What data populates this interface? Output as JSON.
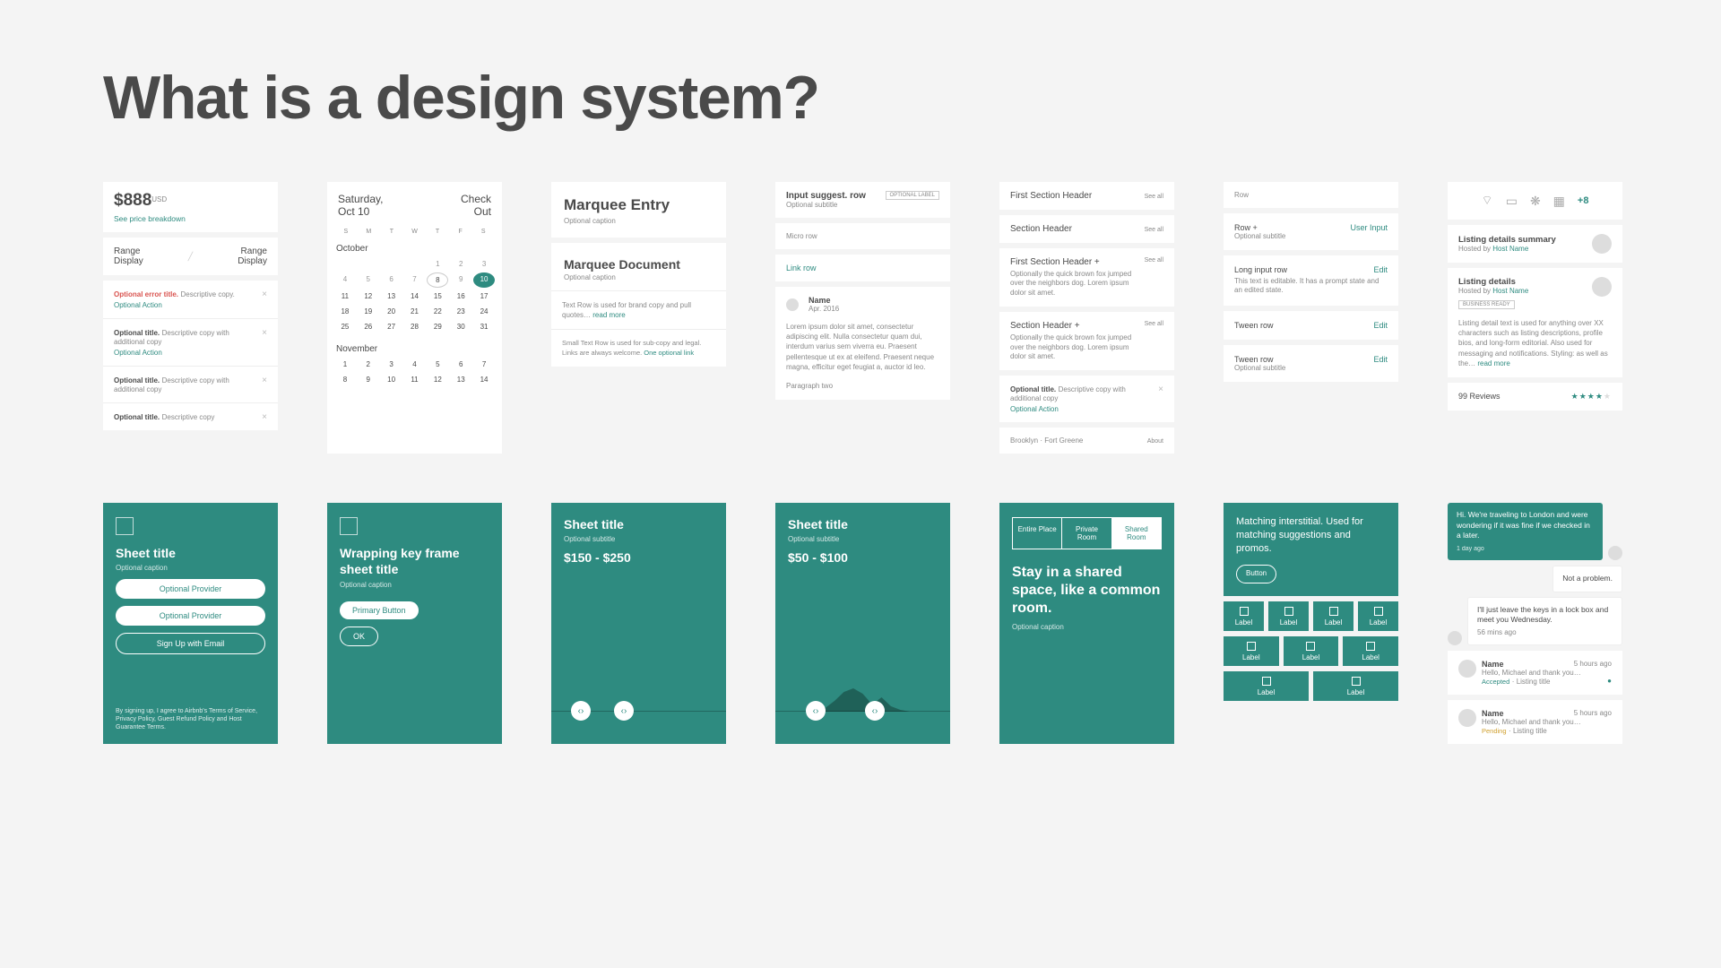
{
  "heading": "What is a design system?",
  "col1": {
    "price": "$888",
    "currency": "USD",
    "see_breakdown": "See price breakdown",
    "range_display": "Range Display",
    "rows": [
      {
        "title": "Optional error title.",
        "copy": "Descriptive copy.",
        "action": "Optional Action",
        "error": true
      },
      {
        "title": "Optional title.",
        "copy": "Descriptive copy with additional copy",
        "action": "Optional Action"
      },
      {
        "title": "Optional title.",
        "copy": "Descriptive copy with additional copy"
      },
      {
        "title": "Optional title.",
        "copy": "Descriptive copy"
      }
    ]
  },
  "col2": {
    "day_label": "Saturday,",
    "date_label": "Oct 10",
    "check": "Check",
    "out": "Out",
    "dow": [
      "S",
      "M",
      "T",
      "W",
      "T",
      "F",
      "S"
    ],
    "month1": "October",
    "month1_days": [
      "",
      "",
      "",
      "",
      "1",
      "2",
      "3",
      "4",
      "5",
      "6",
      "7",
      "8",
      "9",
      "10",
      "11",
      "12",
      "13",
      "14",
      "15",
      "16",
      "17",
      "18",
      "19",
      "20",
      "21",
      "22",
      "23",
      "24",
      "25",
      "26",
      "27",
      "28",
      "29",
      "30",
      "31"
    ],
    "month2": "November",
    "month2_days": [
      "1",
      "2",
      "3",
      "4",
      "5",
      "6",
      "7",
      "8",
      "9",
      "10",
      "11",
      "12",
      "13",
      "14"
    ]
  },
  "col3": {
    "entry_title": "Marquee Entry",
    "entry_caption": "Optional caption",
    "doc_title": "Marquee Document",
    "doc_caption": "Optional caption",
    "textrow": "Text Row is used for brand copy and pull quotes…",
    "readmore": "read more",
    "smallrow": "Small Text Row is used for sub-copy and legal. Links are always welcome.",
    "smalllink": "One optional link"
  },
  "col4": {
    "suggest_title": "Input suggest. row",
    "suggest_sub": "Optional subtitle",
    "suggest_badge": "OPTIONAL LABEL",
    "micro": "Micro row",
    "linkrow": "Link row",
    "name": "Name",
    "date": "Apr. 2016",
    "lorem": "Lorem ipsum dolor sit amet, consectetur adipiscing elit. Nulla consectetur quam dui, interdum varius sem viverra eu. Praesent pellentesque ut ex at eleifend. Praesent neque magna, efficitur eget feugiat a, auctor id leo.",
    "para2": "Paragraph two"
  },
  "col5": {
    "first_header": "First Section Header",
    "section_header": "Section Header",
    "first_header_plus": "First Section Header +",
    "section_header_plus": "Section Header +",
    "sub": "Optionally the quick brown fox jumped over the neighbors dog. Lorem ipsum dolor sit amet.",
    "see_all": "See all",
    "row_title": "Optional title.",
    "row_copy": "Descriptive copy with additional copy",
    "row_action": "Optional Action",
    "loc1": "Brooklyn",
    "loc2": "Fort Greene",
    "about": "About"
  },
  "col6": {
    "row": "Row",
    "rowplus": "Row +",
    "userinput": "User Input",
    "optsub": "Optional subtitle",
    "longinput": "Long input row",
    "longhint": "This text is editable. It has a prompt state and an edited state.",
    "tween": "Tween row",
    "edit": "Edit"
  },
  "col7": {
    "plus8": "+8",
    "summary_title": "Listing details summary",
    "hosted_by": "Hosted by",
    "host_name": "Host Name",
    "details_title": "Listing details",
    "badge": "BUSINESS READY",
    "details_body": "Listing detail text is used for anything over XX characters such as listing descriptions, profile bios, and long-form editorial. Also used for messaging and notifications. Styling: as well as the…",
    "readmore": "read more",
    "reviews": "99 Reviews"
  },
  "sheets": {
    "s1": {
      "title": "Sheet title",
      "caption": "Optional caption",
      "opt_provider": "Optional Provider",
      "signup": "Sign Up with Email",
      "legal": "By signing up, I agree to Airbnb's Terms of Service, Privacy Policy, Guest Refund Policy and Host Guarantee Terms."
    },
    "s2": {
      "title": "Wrapping key frame sheet title",
      "caption": "Optional caption",
      "primary": "Primary Button",
      "ok": "OK"
    },
    "s3": {
      "title": "Sheet title",
      "sub": "Optional subtitle",
      "range": "$150 - $250"
    },
    "s4": {
      "title": "Sheet title",
      "sub": "Optional subtitle",
      "range": "$50 - $100"
    },
    "s5": {
      "seg": [
        "Entire Place",
        "Private Room",
        "Shared Room"
      ],
      "headline": "Stay in a shared space, like a common room.",
      "caption": "Optional caption"
    },
    "s6": {
      "match": "Matching interstitial. Used for matching suggestions and promos.",
      "button": "Button",
      "label": "Label"
    },
    "s7": {
      "m1": "Hi. We're traveling to London and were wondering if it was fine if we checked in a later.",
      "m1_time": "1 day ago",
      "m2": "Not a problem.",
      "m3": "I'll just leave the keys in a lock box and meet you Wednesday.",
      "m3_time": "56 mins ago",
      "name": "Name",
      "body": "Hello, Michael and thank you…",
      "time": "5 hours ago",
      "accepted": "Accepted",
      "pending": "Pending",
      "listing": "Listing title"
    }
  }
}
